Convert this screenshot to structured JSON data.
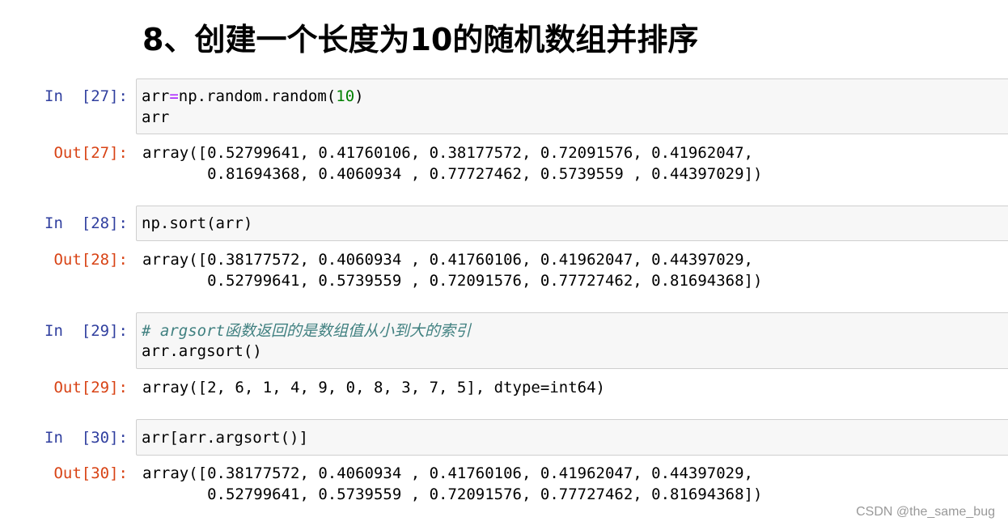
{
  "heading": "8、创建一个长度为10的随机数组并排序",
  "cells": [
    {
      "in_prompt": "In  [27]:",
      "code": {
        "line1": {
          "a": "arr",
          "op": "=",
          "b": "np.random.random(",
          "num": "10",
          "c": ")"
        },
        "line2": "arr"
      },
      "out_prompt": "Out[27]:",
      "output": [
        "array([0.52799641, 0.41760106, 0.38177572, 0.72091576, 0.41962047,",
        "       0.81694368, 0.4060934 , 0.77727462, 0.5739559 , 0.44397029])"
      ]
    },
    {
      "in_prompt": "In  [28]:",
      "code": {
        "line1": "np.sort(arr)"
      },
      "out_prompt": "Out[28]:",
      "output": [
        "array([0.38177572, 0.4060934 , 0.41760106, 0.41962047, 0.44397029,",
        "       0.52799641, 0.5739559 , 0.72091576, 0.77727462, 0.81694368])"
      ]
    },
    {
      "in_prompt": "In  [29]:",
      "code": {
        "comment": "# argsort函数返回的是数组值从小到大的索引",
        "line2": "arr.argsort()"
      },
      "out_prompt": "Out[29]:",
      "output": [
        "array([2, 6, 1, 4, 9, 0, 8, 3, 7, 5], dtype=int64)"
      ]
    },
    {
      "in_prompt": "In  [30]:",
      "code": {
        "line1": "arr[arr.argsort()]"
      },
      "out_prompt": "Out[30]:",
      "output": [
        "array([0.38177572, 0.4060934 , 0.41760106, 0.41962047, 0.44397029,",
        "       0.52799641, 0.5739559 , 0.72091576, 0.77727462, 0.81694368])"
      ]
    }
  ],
  "watermark": "CSDN @the_same_bug"
}
